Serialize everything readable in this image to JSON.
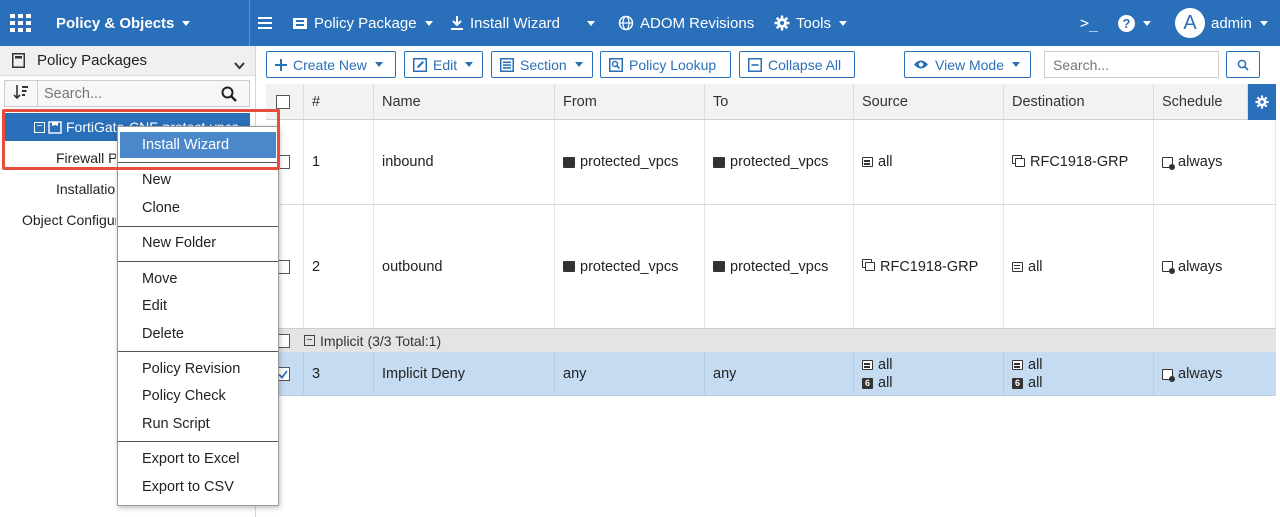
{
  "colors": {
    "brand": "#2a6fb9",
    "selection_row": "#c5dbf1",
    "highlight_box": "#e74c3c"
  },
  "topbar": {
    "app_grid_icon": "grid-icon",
    "module": "Policy & Objects",
    "menu_icon": "hamburger-icon",
    "items": [
      {
        "label": "Policy Package",
        "icon": "package-icon"
      },
      {
        "label": "Install Wizard",
        "icon": "install-icon"
      },
      {
        "label": "ADOM Revisions",
        "icon": "globe-icon"
      },
      {
        "label": "Tools",
        "icon": "gear-icon"
      }
    ],
    "cli_icon": ">_",
    "help_icon": "?",
    "avatar_letter": "A",
    "user": "admin"
  },
  "sidebar": {
    "header": "Policy Packages",
    "search_placeholder": "Search...",
    "tree": [
      {
        "label": "FortiGate-CNF-protect-vpcs",
        "selected": true
      },
      {
        "label": "Firewall Policy"
      },
      {
        "label": "Installation Targets"
      },
      {
        "label": "Object Configurations"
      }
    ]
  },
  "context_menu": {
    "items": [
      "Install Wizard",
      "New",
      "Clone",
      "New Folder",
      "Move",
      "Edit",
      "Delete",
      "Policy Revision",
      "Policy Check",
      "Run Script",
      "Export to Excel",
      "Export to CSV"
    ],
    "highlighted": "Install Wizard"
  },
  "toolbar": {
    "create_new": "Create New",
    "edit": "Edit",
    "section": "Section",
    "policy_lookup": "Policy Lookup",
    "collapse_all": "Collapse All",
    "view_mode": "View Mode",
    "search_placeholder": "Search..."
  },
  "table": {
    "columns": [
      "#",
      "Name",
      "From",
      "To",
      "Source",
      "Destination",
      "Schedule"
    ],
    "rows": [
      {
        "id": "1",
        "name": "inbound",
        "from": "protected_vpcs",
        "to": "protected_vpcs",
        "source": "all",
        "destination": "RFC1918-GRP",
        "schedule": "always"
      },
      {
        "id": "2",
        "name": "outbound",
        "from": "protected_vpcs",
        "to": "protected_vpcs",
        "source": "RFC1918-GRP",
        "destination": "all",
        "schedule": "always"
      }
    ],
    "section": {
      "label": "Implicit (3/3 Total:1)"
    },
    "implicit_row": {
      "id": "3",
      "name": "Implicit Deny",
      "from": "any",
      "to": "any",
      "source_v4": "all",
      "source_v6": "all",
      "destination_v4": "all",
      "destination_v6": "all",
      "schedule": "always",
      "checked": true,
      "v6_badge": "6"
    }
  }
}
